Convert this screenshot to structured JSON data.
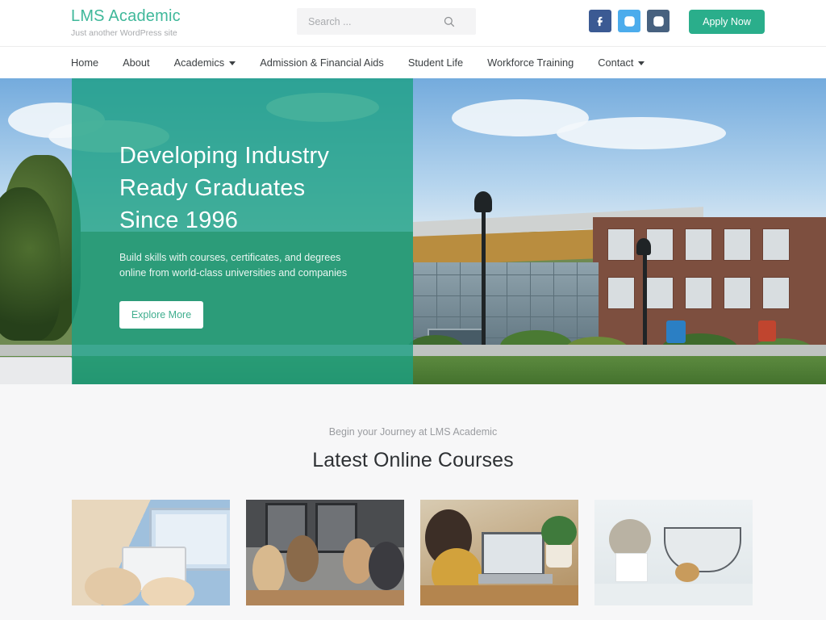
{
  "header": {
    "brand_title": "LMS Academic",
    "brand_tagline": "Just another WordPress site",
    "search_placeholder": "Search ...",
    "search_value": "",
    "search_icon": "search-icon",
    "apply_label": "Apply Now",
    "socials": [
      {
        "name": "facebook",
        "glyph": "f",
        "color": "#3b5a93"
      },
      {
        "name": "instagram",
        "glyph": "camera",
        "color": "#4cacec"
      },
      {
        "name": "instagram",
        "glyph": "camera",
        "color": "#47617f"
      }
    ]
  },
  "nav": {
    "items": [
      {
        "label": "Home",
        "has_caret": false
      },
      {
        "label": "About",
        "has_caret": false
      },
      {
        "label": "Academics",
        "has_caret": true
      },
      {
        "label": "Admission & Financial Aids",
        "has_caret": false
      },
      {
        "label": "Student Life",
        "has_caret": false
      },
      {
        "label": "Workforce Training",
        "has_caret": false
      },
      {
        "label": "Contact",
        "has_caret": true
      }
    ]
  },
  "hero": {
    "title_line1": "Developing Industry",
    "title_line2": "Ready Graduates",
    "title_line3": "Since 1996",
    "subtitle": "Build skills with courses, certificates, and degrees online from world-class universities and companies",
    "cta_label": "Explore More",
    "overlay_color": "#1ba083"
  },
  "courses": {
    "eyebrow": "Begin your Journey at LMS Academic",
    "title": "Latest Online Courses",
    "cards": [
      {
        "image_alt": "hands using tablet beside laptop"
      },
      {
        "image_alt": "team high-five in meeting room"
      },
      {
        "image_alt": "woman working at laptop desk with plant"
      },
      {
        "image_alt": "wire basket with magazines, lavender and cup"
      }
    ]
  },
  "theme": {
    "accent": "#2aae8b",
    "brand_text": "#3fb89a",
    "page_bg": "#f7f7f8"
  }
}
